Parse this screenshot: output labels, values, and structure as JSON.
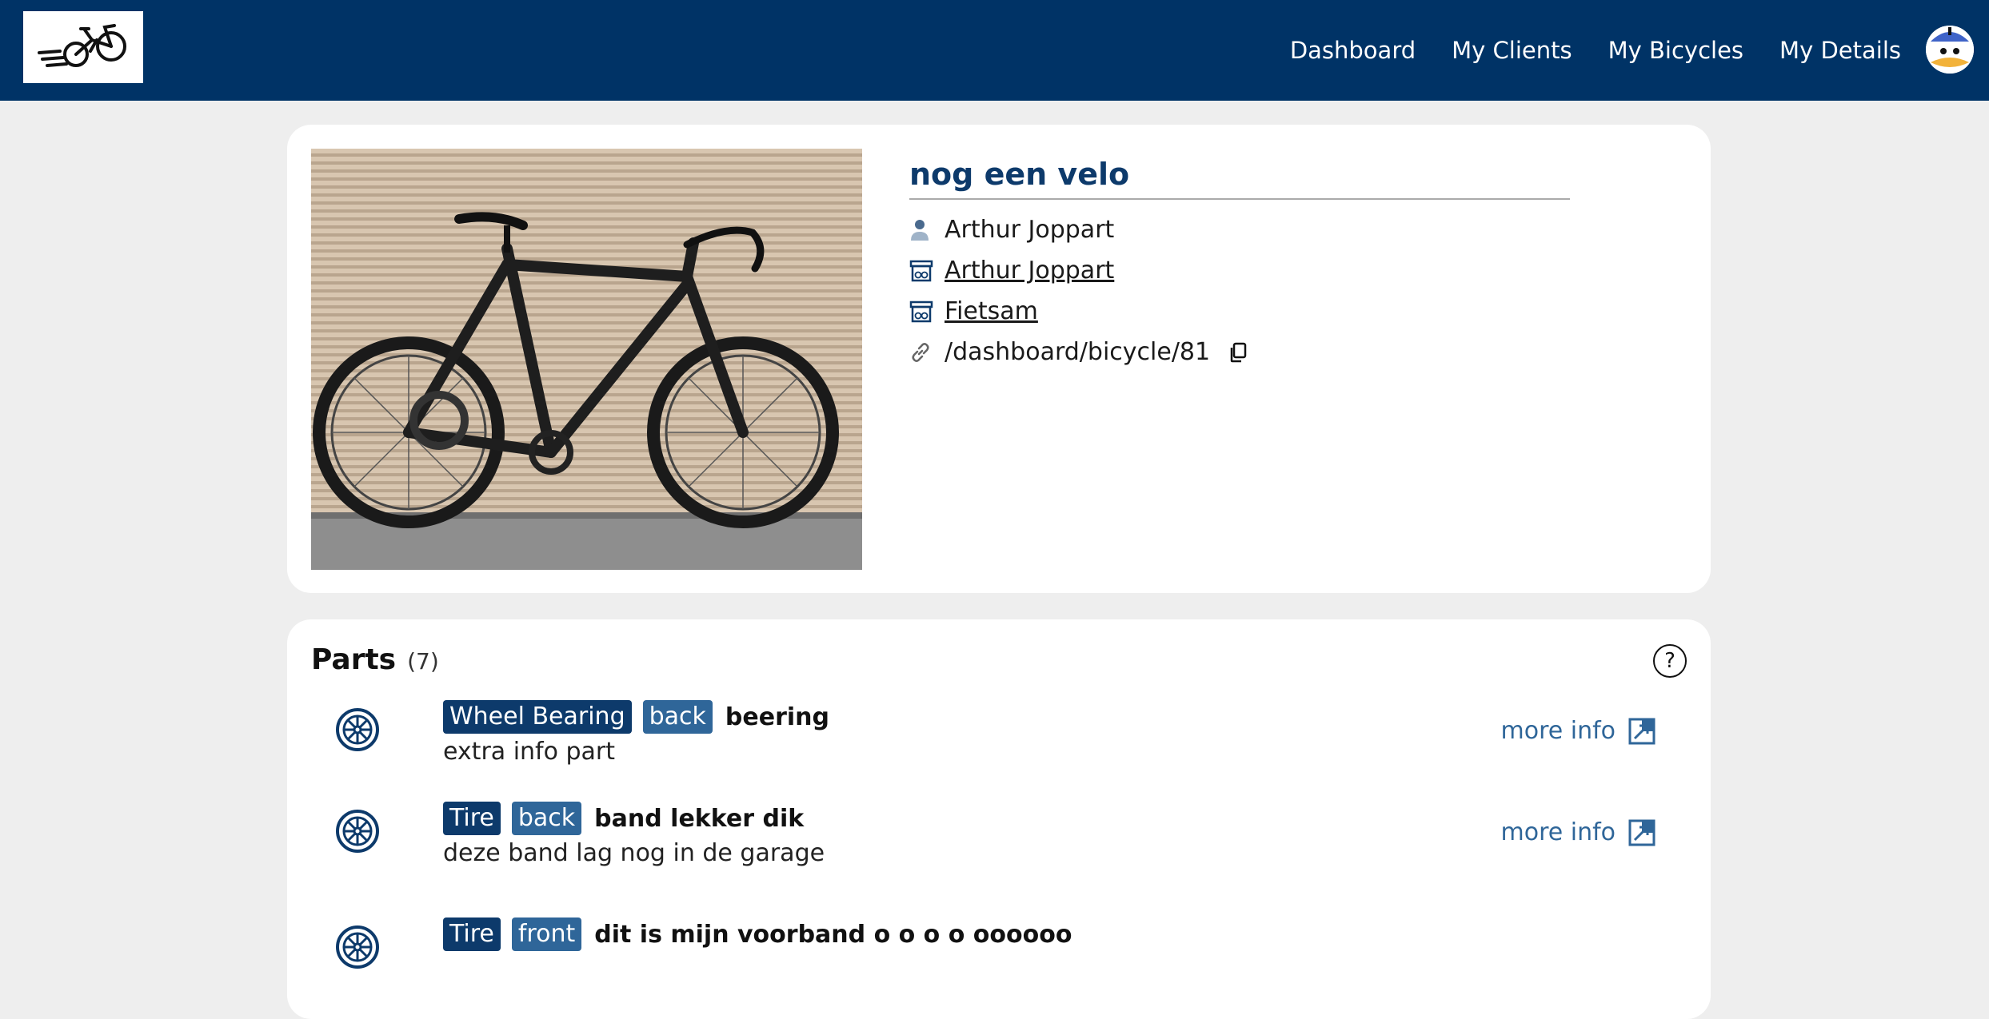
{
  "header": {
    "logo_alt": "bicycle logo",
    "nav": [
      {
        "label": "Dashboard"
      },
      {
        "label": "My Clients"
      },
      {
        "label": "My Bicycles"
      },
      {
        "label": "My Details"
      }
    ],
    "brand_color": "#003366"
  },
  "bicycle": {
    "name": "nog een velo",
    "owner": "Arthur Joppart",
    "shop_1": "Arthur Joppart",
    "shop_2": "Fietsam",
    "link": "/dashboard/bicycle/81"
  },
  "parts": {
    "title": "Parts",
    "count": "(7)",
    "items": [
      {
        "type": "Wheel Bearing",
        "position": "back",
        "name": "beering",
        "description": "extra info part",
        "more_label": "more info"
      },
      {
        "type": "Tire",
        "position": "back",
        "name": "band lekker dik",
        "description": "deze band lag nog in de garage",
        "more_label": "more info"
      },
      {
        "type": "Tire",
        "position": "front",
        "name": "dit is mijn voorband o o o o oooooo",
        "description": "",
        "more_label": ""
      }
    ]
  },
  "icons": {
    "owner": "person-icon",
    "shop": "shop-icon",
    "link": "link-icon",
    "copy": "copy-icon",
    "help": "help-icon",
    "part": "wheel-icon",
    "external": "external-link-icon"
  },
  "colors": {
    "tag_type": "#0d3a6b",
    "tag_position": "#2f6699",
    "link_color": "#2f6699"
  }
}
